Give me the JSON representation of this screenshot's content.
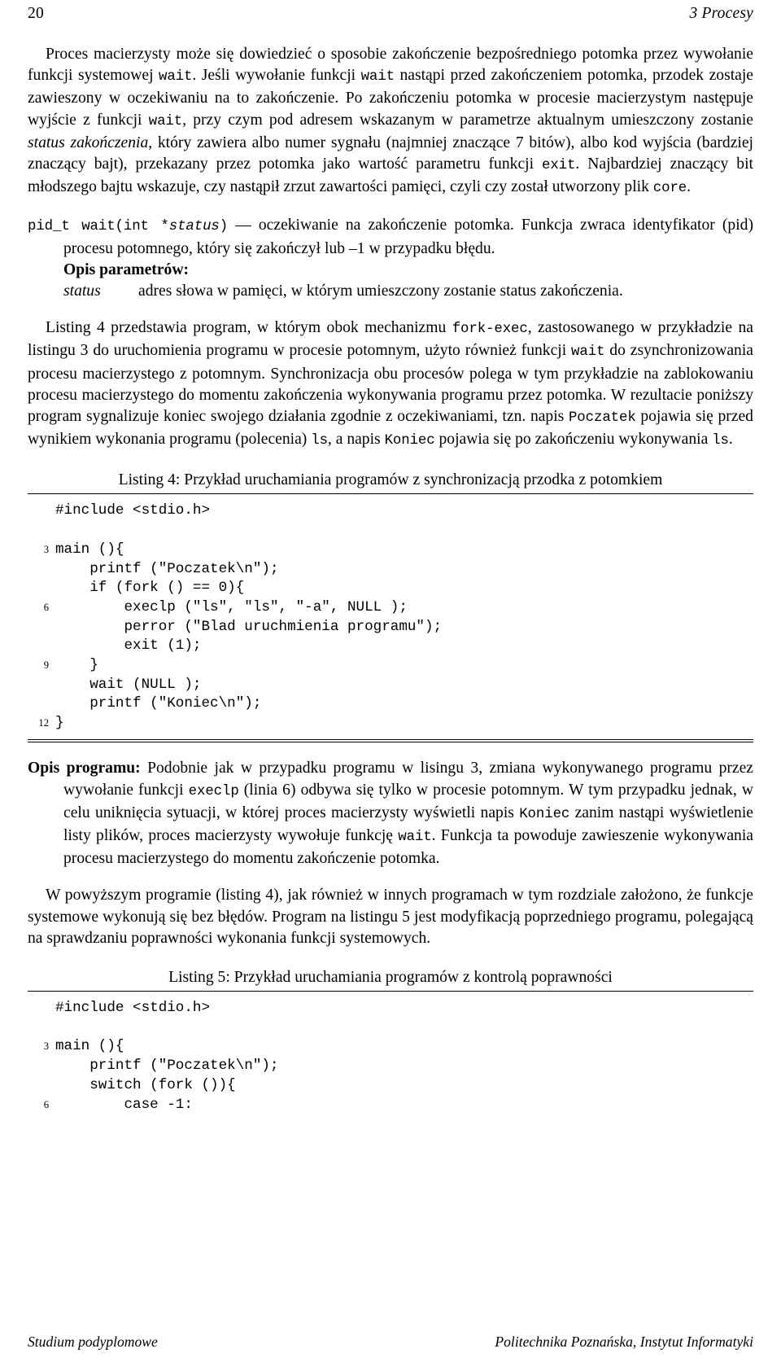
{
  "header": {
    "page_number": "20",
    "chapter": "3 Procesy"
  },
  "paragraphs": {
    "p1_part1": "Proces macierzysty może się dowiedzieć o sposobie zakończenie bezpośredniego potomka przez wywołanie funkcji systemowej ",
    "p1_code1": "wait",
    "p1_part2": ". Jeśli wywołanie funkcji ",
    "p1_code2": "wait",
    "p1_part3": " nastąpi przed zakończeniem potomka, przodek zostaje zawieszony w oczekiwaniu na to zakończenie. Po zakończeniu potomka w procesie macierzystym następuje wyjście z funkcji ",
    "p1_code3": "wait",
    "p1_part4": ", przy czym pod adresem wskazanym w parametrze aktualnym umieszczony zostanie ",
    "p1_italic1": "status zakończenia",
    "p1_part5": ", który zawiera albo numer sygnału (najmniej znaczące 7 bitów), albo kod wyjścia (bardziej znaczący bajt), przekazany przez potomka jako wartość parametru funkcji ",
    "p1_code4": "exit",
    "p1_part6": ". Najbardziej znaczący bit młodszego bajtu wskazuje, czy nastąpił zrzut zawartości pamięci, czyli czy został utworzony plik ",
    "p1_code5": "core",
    "p1_part7": "."
  },
  "function_desc": {
    "signature_code": "pid_t wait(int *",
    "signature_italic": "status",
    "signature_code_end": ")",
    "desc": " — oczekiwanie na zakończenie potomka. Funkcja zwraca identyfikator (pid) procesu potomnego, który się zakończył lub –1 w przypadku błędu.",
    "params_heading": "Opis parametrów:",
    "param_name": "status",
    "param_desc": "adres słowa w pamięci, w którym umieszczony zostanie status zakończenia."
  },
  "paragraph2": {
    "part1": "Listing 4 przedstawia program, w którym obok mechanizmu ",
    "code1": "fork-exec",
    "part2": ", zastosowanego w przykładzie na listingu 3 do uruchomienia programu w procesie potomnym, użyto również funkcji ",
    "code2": "wait",
    "part3": " do zsynchronizowania procesu macierzystego z potomnym. Synchronizacja obu procesów polega w tym przykładzie na zablokowaniu procesu macierzystego do momentu zakończenia wykonywania programu przez potomka. W rezultacie poniższy program sygnalizuje koniec swojego działania zgodnie z oczekiwaniami, tzn. napis ",
    "code3": "Poczatek",
    "part4": " pojawia się przed wynikiem wykonania programu (polecenia) ",
    "code4": "ls",
    "part5": ", a napis ",
    "code5": "Koniec",
    "part6": " pojawia się po zakończeniu wykonywania ",
    "code6": "ls",
    "part7": "."
  },
  "listing4": {
    "caption": "Listing 4: Przykład uruchamiania programów z synchronizacją przodka z potomkiem",
    "lines": [
      {
        "no": "",
        "text": "#include <stdio.h>"
      },
      {
        "no": "",
        "text": ""
      },
      {
        "no": "3",
        "text": "main (){"
      },
      {
        "no": "",
        "text": "    printf (\"Poczatek\\n\");"
      },
      {
        "no": "",
        "text": "    if (fork () == 0){"
      },
      {
        "no": "6",
        "text": "        execlp (\"ls\", \"ls\", \"-a\", NULL );"
      },
      {
        "no": "",
        "text": "        perror (\"Blad uruchmienia programu\");"
      },
      {
        "no": "",
        "text": "        exit (1);"
      },
      {
        "no": "9",
        "text": "    }"
      },
      {
        "no": "",
        "text": "    wait (NULL );"
      },
      {
        "no": "",
        "text": "    printf (\"Koniec\\n\");"
      },
      {
        "no": "12",
        "text": "}"
      }
    ]
  },
  "paragraph3": {
    "bold": "Opis programu:",
    "part1": " Podobnie jak w przypadku programu w lisingu 3, zmiana wykonywanego programu przez wywołanie funkcji ",
    "code1": "execlp",
    "part2": " (linia 6) odbywa się tylko w procesie potomnym. W tym przypadku jednak, w celu uniknięcia sytuacji, w której proces macierzysty wyświetli napis ",
    "code2": "Koniec",
    "part3": " zanim nastąpi wyświetlenie listy plików, proces macierzysty wywołuje funkcję ",
    "code3": "wait",
    "part4": ". Funkcja ta powoduje zawieszenie wykonywania procesu macierzystego do momentu zakończenie potomka."
  },
  "paragraph4": {
    "text": "W powyższym programie (listing 4), jak również w innych programach w tym rozdziale założono, że funkcje systemowe wykonują się bez błędów. Program na listingu 5 jest modyfikacją poprzedniego programu, polegającą na sprawdzaniu poprawności wykonania funkcji systemowych."
  },
  "listing5": {
    "caption": "Listing 5: Przykład uruchamiania programów z kontrolą poprawności",
    "lines": [
      {
        "no": "",
        "text": "#include <stdio.h>"
      },
      {
        "no": "",
        "text": ""
      },
      {
        "no": "3",
        "text": "main (){"
      },
      {
        "no": "",
        "text": "    printf (\"Poczatek\\n\");"
      },
      {
        "no": "",
        "text": "    switch (fork ()){"
      },
      {
        "no": "6",
        "text": "        case -1:"
      }
    ]
  },
  "footer": {
    "left": "Studium podyplomowe",
    "right": "Politechnika Poznańska, Instytut Informatyki"
  }
}
